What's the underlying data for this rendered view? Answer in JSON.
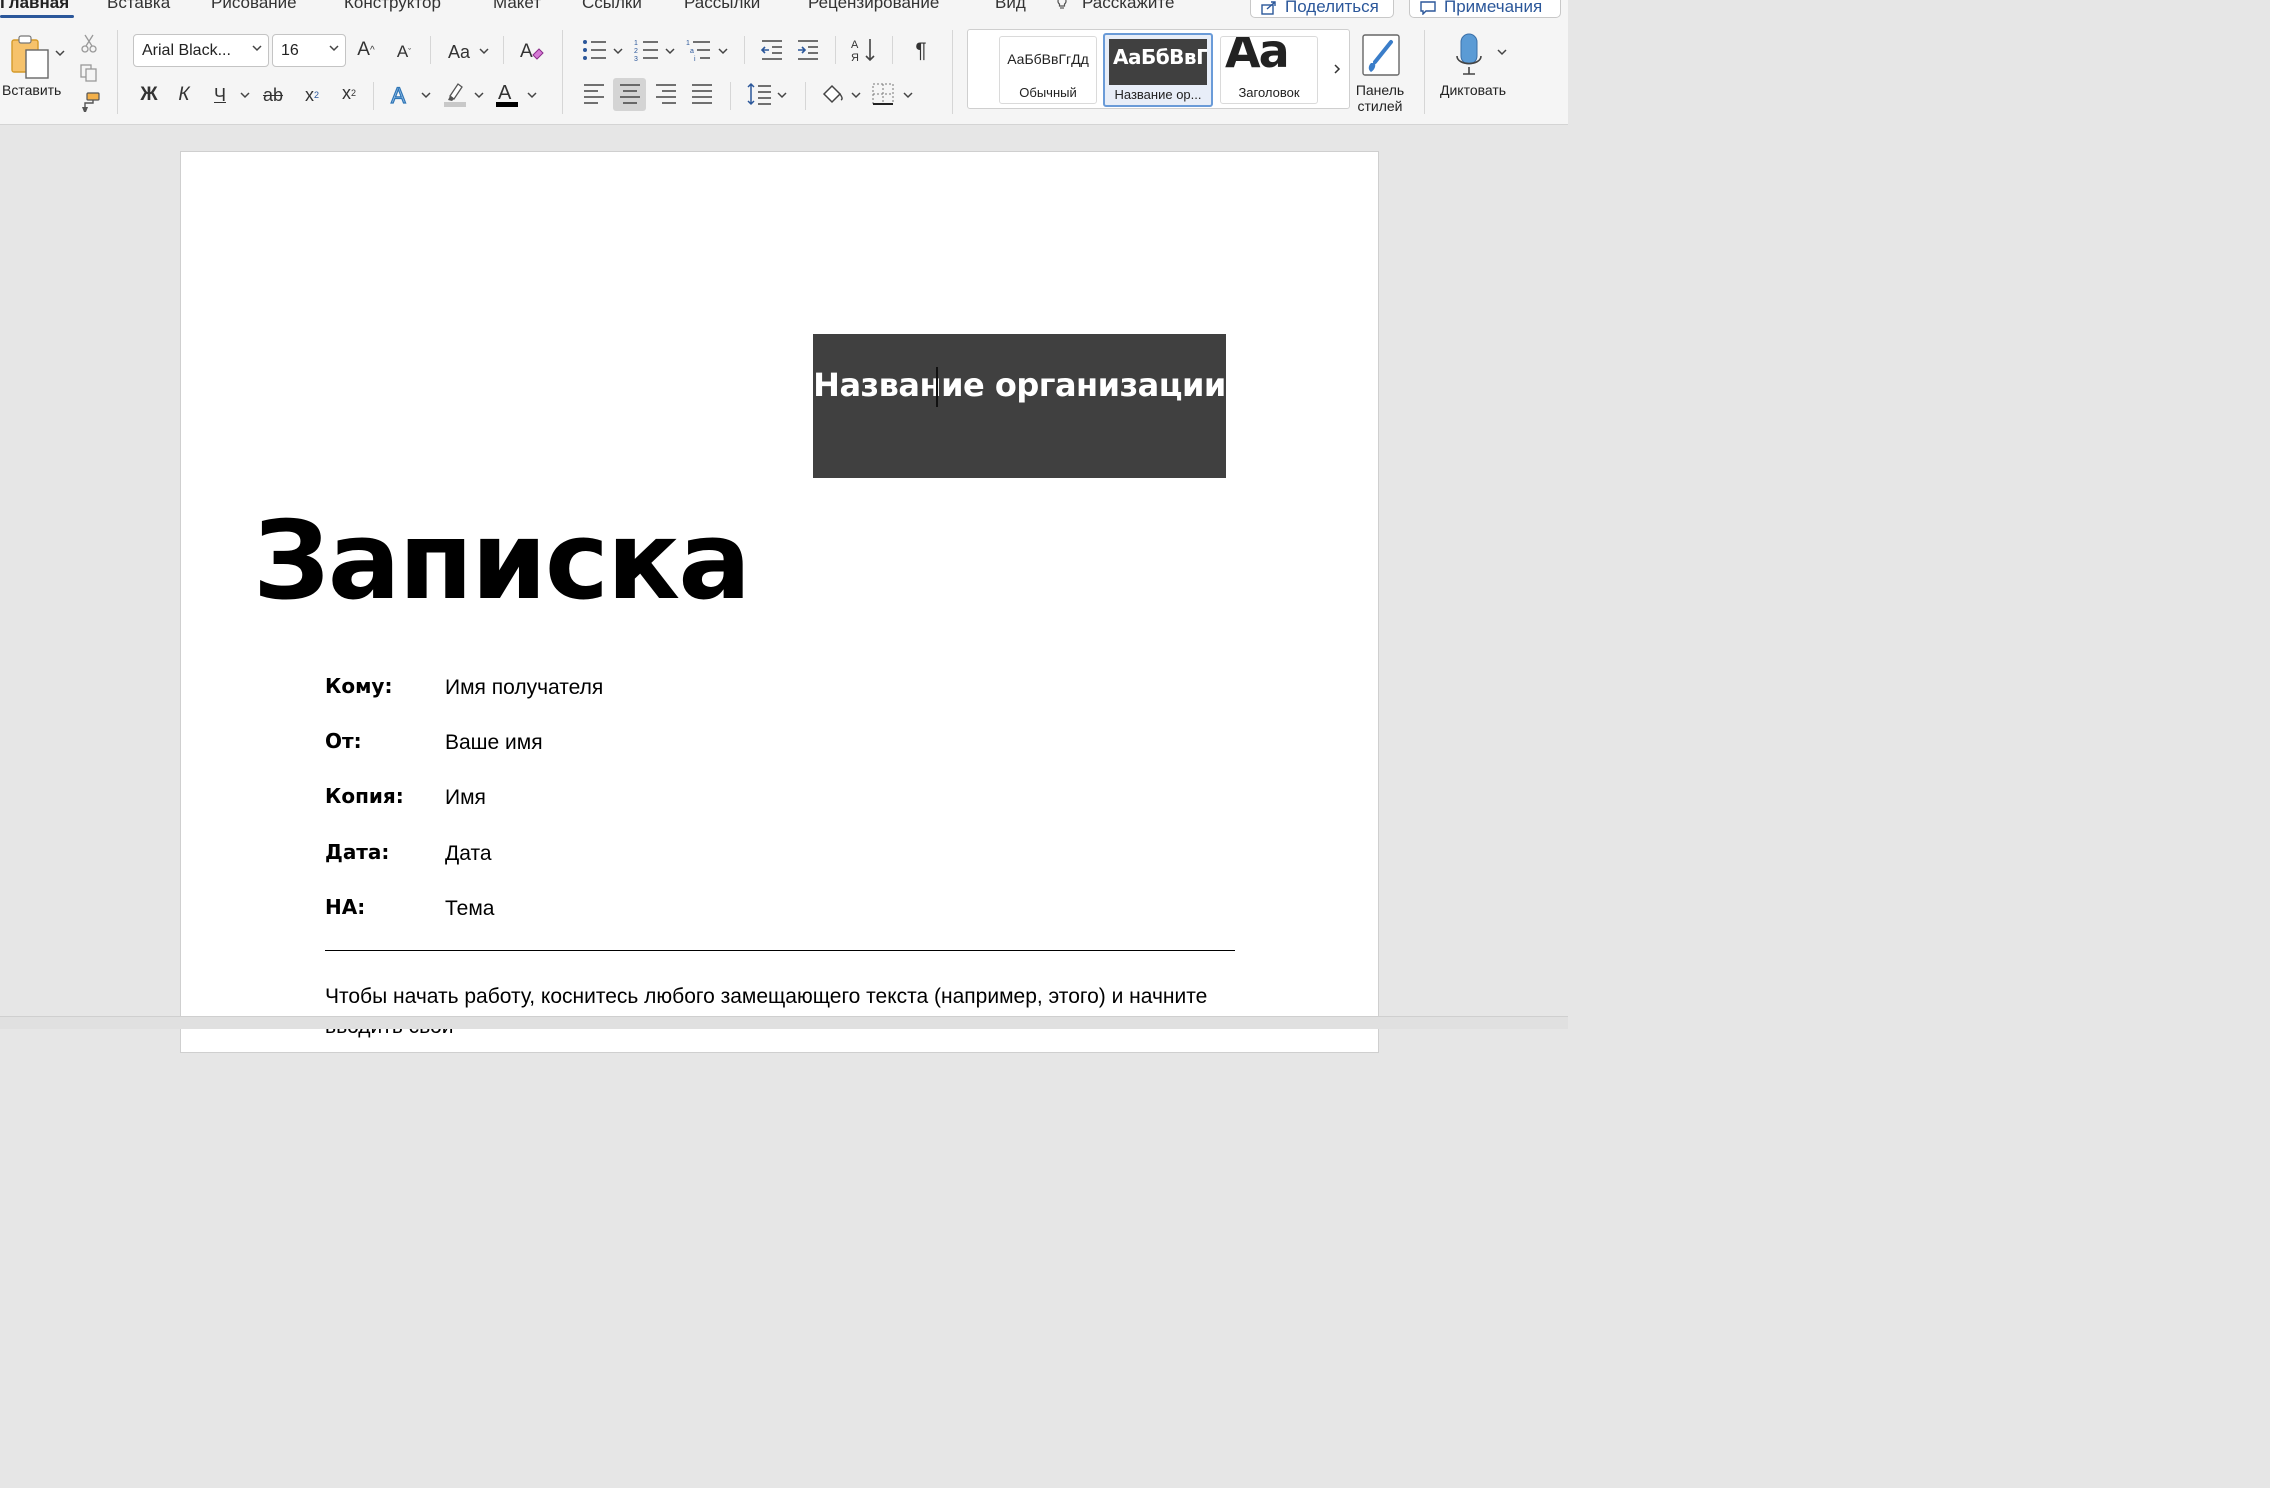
{
  "tabs": {
    "items": [
      "Главная",
      "Вставка",
      "Рисование",
      "Конструктор",
      "Макет",
      "Ссылки",
      "Рассылки",
      "Рецензирование",
      "Вид",
      "Расскажите"
    ],
    "share": "Поделиться",
    "comments": "Примечания"
  },
  "ribbon": {
    "paste_label": "Вставить",
    "font_name": "Arial Black...",
    "font_size": "16",
    "case_label": "Aa",
    "bold": "Ж",
    "italic": "К",
    "underline": "Ч",
    "strike": "ab",
    "subscript": "x",
    "superscript": "x",
    "pilcrow": "¶",
    "styles": [
      {
        "preview": "АаБбВвГгДд",
        "name": "Обычный"
      },
      {
        "preview": "АаБбВвГ",
        "name": "Название ор..."
      },
      {
        "preview": "Аа",
        "name": "Заголовок"
      }
    ],
    "styles_pane": "Панель стилей",
    "dictate": "Диктовать"
  },
  "document": {
    "org_name": "Название организации",
    "title": "Записка",
    "fields": [
      {
        "label": "Кому:",
        "value": "Имя получателя"
      },
      {
        "label": "От:",
        "value": "Ваше имя"
      },
      {
        "label": "Копия:",
        "value": "Имя"
      },
      {
        "label": "Дата:",
        "value": "Дата"
      },
      {
        "label": "НА:",
        "value": "Тема"
      }
    ],
    "body": "Чтобы начать работу, коснитесь любого замещающего текста (например, этого) и начните вводить свой"
  },
  "colors": {
    "accent": "#2b579a",
    "org_box": "#404040",
    "highlight": "#c8c8c8",
    "font_color": "#000000",
    "text_effect": "#2e75b6"
  }
}
